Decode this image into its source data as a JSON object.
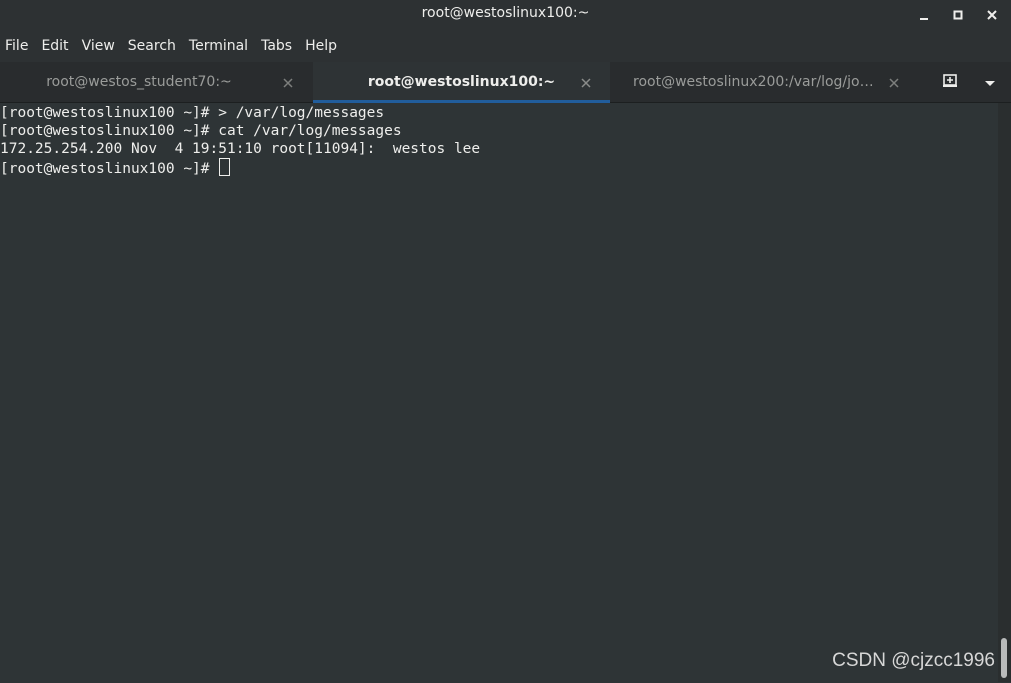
{
  "window": {
    "title": "root@westoslinux100:~"
  },
  "menu": {
    "items": [
      {
        "name": "menu-file",
        "label": "File"
      },
      {
        "name": "menu-edit",
        "label": "Edit"
      },
      {
        "name": "menu-view",
        "label": "View"
      },
      {
        "name": "menu-search",
        "label": "Search"
      },
      {
        "name": "menu-terminal",
        "label": "Terminal"
      },
      {
        "name": "menu-tabs",
        "label": "Tabs"
      },
      {
        "name": "menu-help",
        "label": "Help"
      }
    ]
  },
  "tabs": [
    {
      "label": "root@westos_student70:~",
      "active": false
    },
    {
      "label": "root@westoslinux100:~",
      "active": true
    },
    {
      "label": "root@westoslinux200:/var/log/jour…",
      "active": false
    }
  ],
  "terminal": {
    "lines": [
      "[root@westoslinux100 ~]# > /var/log/messages",
      "[root@westoslinux100 ~]# cat /var/log/messages",
      "172.25.254.200 Nov  4 19:51:10 root[11094]:  westos lee",
      "[root@westoslinux100 ~]# "
    ]
  },
  "icons": {
    "minimize": "minimize-icon",
    "maximize": "maximize-icon",
    "close": "close-icon",
    "new_tab": "new-tab-icon",
    "tab_menu": "chevron-down-icon"
  },
  "watermark": "CSDN @cjzcc1996",
  "colors": {
    "background": "#2e3436",
    "accent": "#215d9c",
    "text": "#eeeeec"
  }
}
